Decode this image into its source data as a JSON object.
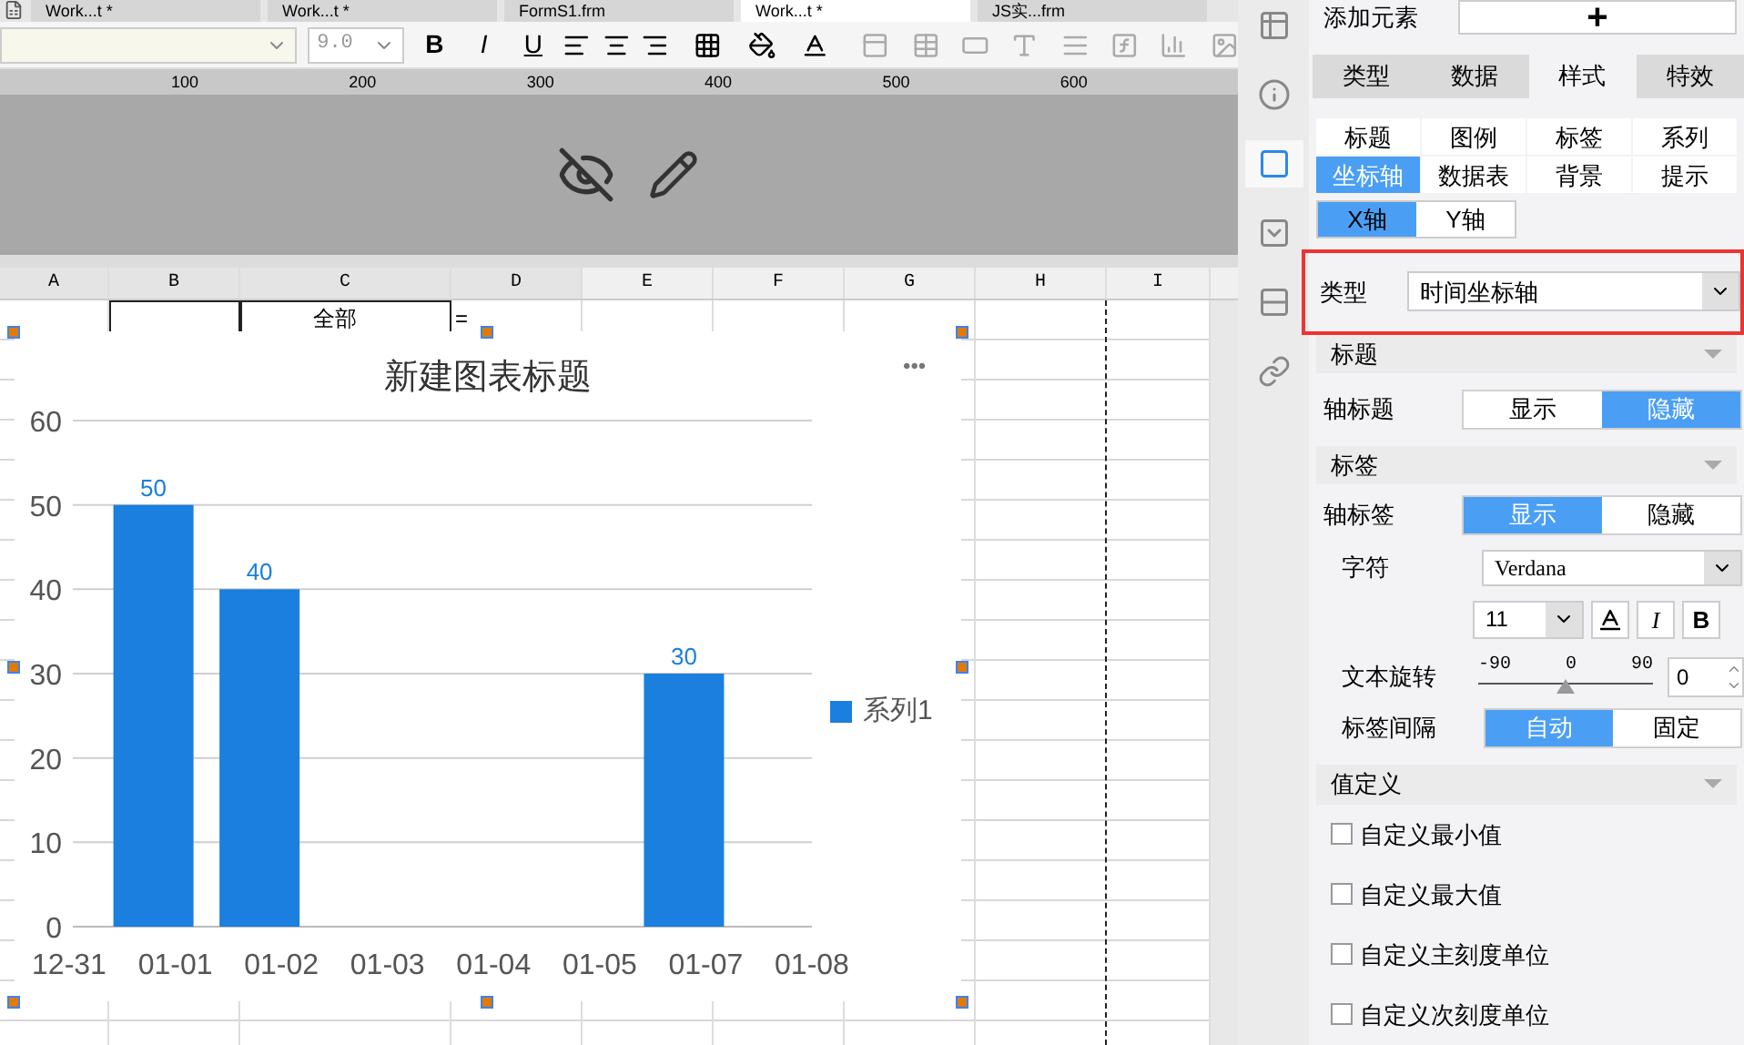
{
  "doc_tabs": [
    {
      "label": "Work...t *",
      "selected": false
    },
    {
      "label": "Work...t *",
      "selected": false
    },
    {
      "label": "FormS1.frm",
      "selected": false
    },
    {
      "label": "Work...t *",
      "selected": true
    },
    {
      "label": "JS实...frm",
      "selected": false
    }
  ],
  "toolbar": {
    "font_size": "9.0",
    "bold": "B",
    "italic": "I",
    "underline": "U"
  },
  "ruler": [
    "100",
    "200",
    "300",
    "400",
    "500",
    "600"
  ],
  "columns": [
    "A",
    "B",
    "C",
    "D",
    "E",
    "F",
    "G",
    "H",
    "I"
  ],
  "cells": [
    "全部",
    "="
  ],
  "chart": {
    "title": "新建图表标题",
    "menu": "•••",
    "chart_data": {
      "type": "bar",
      "x": [
        "12-31",
        "01-01",
        "01-02",
        "01-03",
        "01-04",
        "01-05",
        "01-07",
        "01-08"
      ],
      "series": [
        {
          "name": "系列1",
          "color": "#1a7fde",
          "values": [
            null,
            50,
            40,
            null,
            null,
            null,
            30,
            null
          ]
        }
      ],
      "ylim": [
        0,
        60
      ],
      "yticks": [
        0,
        10,
        20,
        30,
        40,
        50,
        60
      ],
      "grid": true,
      "data_labels": true
    }
  },
  "side_icons": [
    {
      "selected": false
    },
    {
      "selected": false
    },
    {
      "selected": true
    },
    {
      "selected": false
    },
    {
      "selected": false
    },
    {
      "selected": false
    }
  ],
  "panel": {
    "add_label": "添加元素",
    "add_button": "+",
    "main_tabs": [
      {
        "label": "类型",
        "selected": false
      },
      {
        "label": "数据",
        "selected": false
      },
      {
        "label": "样式",
        "selected": true
      },
      {
        "label": "特效",
        "selected": false
      }
    ],
    "sub_tabs": [
      {
        "label": "标题",
        "selected": false
      },
      {
        "label": "图例",
        "selected": false
      },
      {
        "label": "标签",
        "selected": false
      },
      {
        "label": "系列",
        "selected": false
      },
      {
        "label": "坐标轴",
        "selected": true
      },
      {
        "label": "数据表",
        "selected": false
      },
      {
        "label": "背景",
        "selected": false
      },
      {
        "label": "提示",
        "selected": false
      }
    ],
    "axis_tabs": [
      {
        "label": "X轴",
        "selected": true
      },
      {
        "label": "Y轴",
        "selected": false
      }
    ],
    "type": {
      "label": "类型",
      "value": "时间坐标轴"
    },
    "title_section": {
      "header": "标题",
      "label": "轴标题",
      "options": [
        {
          "label": "显示",
          "selected": false
        },
        {
          "label": "隐藏",
          "selected": true
        }
      ]
    },
    "label_section": {
      "header": "标签",
      "label": "轴标签",
      "options": [
        {
          "label": "显示",
          "selected": true
        },
        {
          "label": "隐藏",
          "selected": false
        }
      ],
      "font_label": "字符",
      "font": "Verdana",
      "size": "11",
      "italic": "I",
      "bold": "B",
      "rotation_label": "文本旋转",
      "rotation_ticks": [
        "-90",
        "0",
        "90"
      ],
      "rotation": {
        "level": 0.5,
        "value": "0"
      },
      "interval_label": "标签间隔",
      "interval_options": [
        {
          "label": "自动",
          "selected": true
        },
        {
          "label": "固定",
          "selected": false
        }
      ]
    },
    "value_section": {
      "header": "值定义",
      "checks": [
        {
          "label": "自定义最小值",
          "checked": false
        },
        {
          "label": "自定义最大值",
          "checked": false
        },
        {
          "label": "自定义主刻度单位",
          "checked": false
        },
        {
          "label": "自定义次刻度单位",
          "checked": false
        }
      ]
    }
  }
}
